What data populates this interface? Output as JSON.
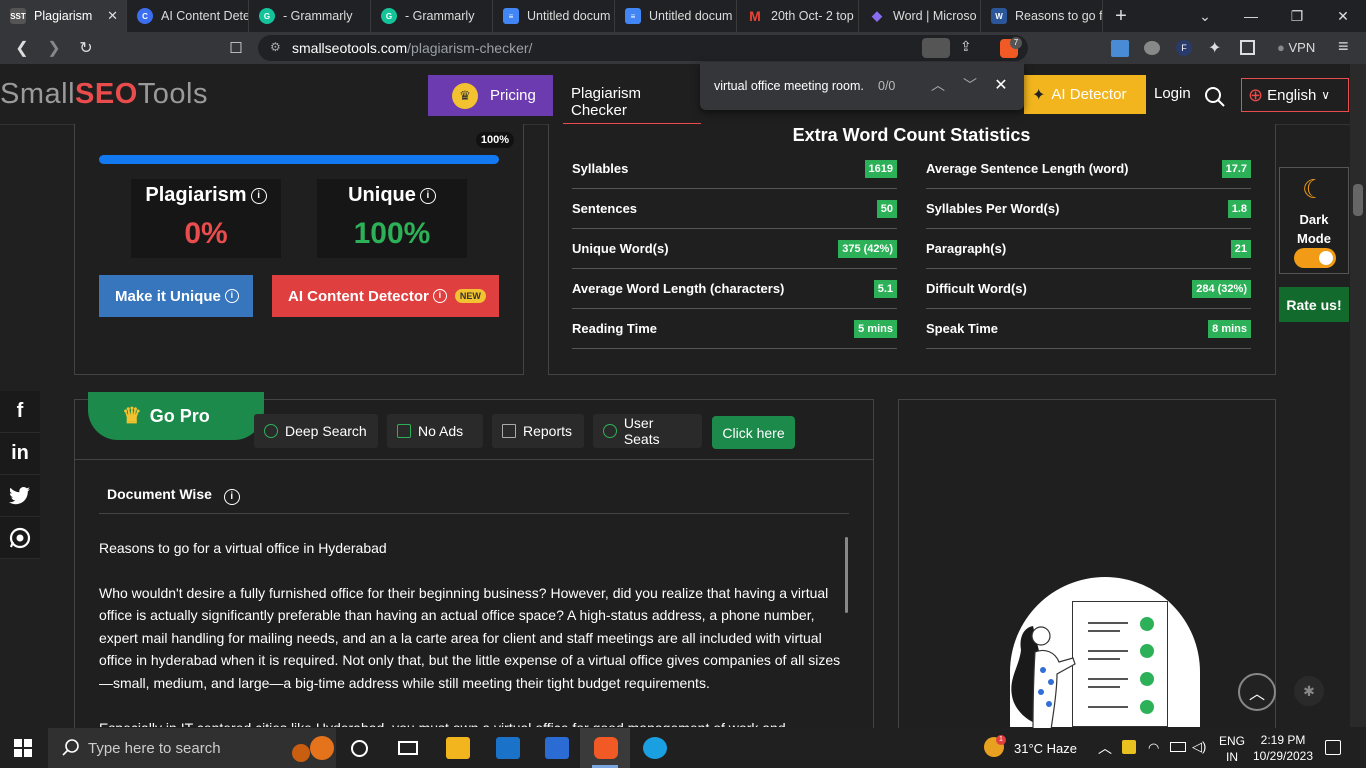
{
  "browser": {
    "tabs": [
      {
        "title": "Plagiarism",
        "fav": "SST",
        "color": "#e94c4c",
        "active": true
      },
      {
        "title": "AI Content Dete",
        "fav": "C",
        "color": "#3b6ff0"
      },
      {
        "title": "- Grammarly",
        "fav": "G",
        "color": "#15c39a"
      },
      {
        "title": "- Grammarly",
        "fav": "G",
        "color": "#15c39a"
      },
      {
        "title": "Untitled docum",
        "fav": "≡",
        "color": "#4285f4"
      },
      {
        "title": "Untitled docum",
        "fav": "≡",
        "color": "#4285f4"
      },
      {
        "title": "20th Oct- 2 top",
        "fav": "M",
        "color": "#ea4335"
      },
      {
        "title": "Word | Microso",
        "fav": "◆",
        "color": "#6a4fe0"
      },
      {
        "title": "Reasons to go f",
        "fav": "W",
        "color": "#2b579a"
      }
    ],
    "new_tab": "+",
    "url_domain": "smallseotools.com",
    "url_path": "/plagiarism-checker/",
    "vpn_label": "VPN",
    "brave_count": "7",
    "ext_letter": "F"
  },
  "header": {
    "logo_small": "Small",
    "logo_seo": "SEO",
    "logo_tools": "Tools",
    "pricing": "Pricing",
    "plagiarism_checker": "Plagiarism Checker",
    "ai_detector": "AI Detector",
    "login": "Login",
    "language": "English"
  },
  "findbar": {
    "query": "virtual office meeting room.",
    "count": "0/0"
  },
  "results": {
    "progress_percent": 100,
    "progress_label": "100%",
    "plagiarism_label": "Plagiarism",
    "plagiarism_value": "0%",
    "unique_label": "Unique",
    "unique_value": "100%",
    "make_unique": "Make it Unique",
    "ai_content_detector": "AI Content Detector",
    "new_badge": "NEW"
  },
  "stats": {
    "title": "Extra Word Count Statistics",
    "left": [
      {
        "label": "Syllables",
        "value": "1619"
      },
      {
        "label": "Sentences",
        "value": "50"
      },
      {
        "label": "Unique Word(s)",
        "value": "375 (42%)"
      },
      {
        "label": "Average Word Length (characters)",
        "value": "5.1"
      },
      {
        "label": "Reading Time",
        "value": "5 mins"
      }
    ],
    "right": [
      {
        "label": "Average Sentence Length (word)",
        "value": "17.7"
      },
      {
        "label": "Syllables Per Word(s)",
        "value": "1.8"
      },
      {
        "label": "Paragraph(s)",
        "value": "21"
      },
      {
        "label": "Difficult Word(s)",
        "value": "284 (32%)"
      },
      {
        "label": "Speak Time",
        "value": "8 mins"
      }
    ]
  },
  "widget": {
    "dark_mode_line1": "Dark",
    "dark_mode_line2": "Mode",
    "rate_us": "Rate us!"
  },
  "social": [
    "f",
    "in",
    "t",
    "w"
  ],
  "gopro": {
    "title": "Go Pro",
    "features": [
      "Deep Search",
      "No Ads",
      "Reports",
      "User Seats"
    ],
    "cta": "Click here"
  },
  "document": {
    "heading": "Document Wise",
    "paragraphs": [
      "Reasons to go for a virtual office in Hyderabad",
      "Who wouldn't desire a fully furnished office for their beginning business? However, did you realize that having a virtual office is actually significantly preferable than having an actual office space? A high-status address, a phone number, expert mail handling for mailing needs, and an a la carte area for client and staff meetings are all included with virtual office in hyderabad when it is required. Not only that, but the little expense of a virtual office gives companies of all sizes—small, medium, and large—a big-time address while still meeting their tight budget requirements.",
      "Especially in IT centered cities like Hyderabad, you must own a virtual office for good management of work and"
    ]
  },
  "taskbar": {
    "search_placeholder": "Type here to search",
    "weather": "31°C  Haze",
    "lang_line1": "ENG",
    "lang_line2": "IN",
    "time": "2:19 PM",
    "date": "10/29/2023",
    "notif_count": "1"
  }
}
